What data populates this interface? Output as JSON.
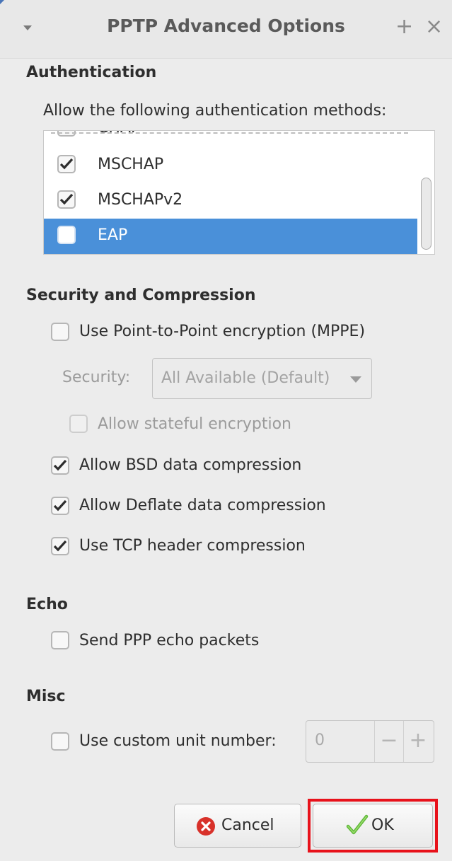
{
  "window": {
    "title": "PPTP Advanced Options",
    "menu_icon": "chevron-down-icon",
    "maximize_glyph": "+",
    "close_glyph": "×"
  },
  "authentication": {
    "heading": "Authentication",
    "intro": "Allow the following authentication methods:",
    "methods": [
      {
        "label": "CHAP",
        "checked": false,
        "selected": false,
        "partial": true
      },
      {
        "label": "MSCHAP",
        "checked": true,
        "selected": false
      },
      {
        "label": "MSCHAPv2",
        "checked": true,
        "selected": false
      },
      {
        "label": "EAP",
        "checked": false,
        "selected": true
      }
    ]
  },
  "security": {
    "heading": "Security and Compression",
    "mppe_label": "Use Point-to-Point encryption (MPPE)",
    "mppe_checked": false,
    "security_label": "Security:",
    "security_value": "All Available (Default)",
    "stateful_label": "Allow stateful encryption",
    "stateful_checked": false,
    "bsd_label": "Allow BSD data compression",
    "bsd_checked": true,
    "deflate_label": "Allow Deflate data compression",
    "deflate_checked": true,
    "tcp_label": "Use TCP header compression",
    "tcp_checked": true
  },
  "echo": {
    "heading": "Echo",
    "send_label": "Send PPP echo packets",
    "send_checked": false
  },
  "misc": {
    "heading": "Misc",
    "unit_label": "Use custom unit number:",
    "unit_checked": false,
    "unit_value": "0",
    "minus_glyph": "−",
    "plus_glyph": "+"
  },
  "buttons": {
    "cancel_label": "Cancel",
    "ok_label": "OK"
  },
  "colors": {
    "selection": "#4a90d9",
    "highlight_outline": "#e8121b"
  }
}
